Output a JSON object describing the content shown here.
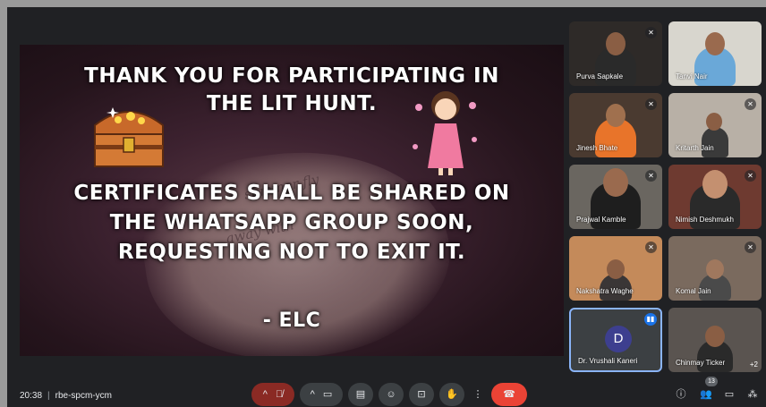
{
  "slide": {
    "line1a": "THANK YOU FOR PARTICIPATING IN",
    "line1b": "THE LIT HUNT.",
    "line2a": "CERTIFICATES SHALL BE SHARED ON",
    "line2b": "THE WHATSAPP GROUP SOON,",
    "line2c": "REQUESTING NOT TO EXIT IT.",
    "signature": "- ELC"
  },
  "participants": [
    {
      "name": "Purva Sapkale"
    },
    {
      "name": "Tanvi Nair"
    },
    {
      "name": "Jinesh Bhate"
    },
    {
      "name": "Kritarth Jain"
    },
    {
      "name": "Prajwal Kamble"
    },
    {
      "name": "Nimish Deshmukh"
    },
    {
      "name": "Nakshatra Waghe"
    },
    {
      "name": "Komal Jain"
    },
    {
      "name": "Dr. Vrushali Kaneri",
      "initial": "D"
    },
    {
      "name": "Chinmay Ticker",
      "more": "+2"
    }
  ],
  "bottombar": {
    "time": "20:38",
    "meeting_code": "rbe-spcm-ycm",
    "participant_count": "13"
  },
  "icons": {
    "mic": "mic-off-icon",
    "camera": "camera-icon",
    "captions": "captions-icon",
    "emoji": "emoji-icon",
    "present": "present-icon",
    "hand": "raise-hand-icon",
    "more": "more-options-icon",
    "end": "end-call-icon",
    "info": "info-icon",
    "people": "people-icon",
    "chat": "chat-icon",
    "activities": "activities-icon"
  },
  "colors": {
    "end_call": "#ea4335",
    "active_border": "#8ab4f8",
    "avatar_bg": "#3d3f8f",
    "speaking": "#1a73e8"
  }
}
